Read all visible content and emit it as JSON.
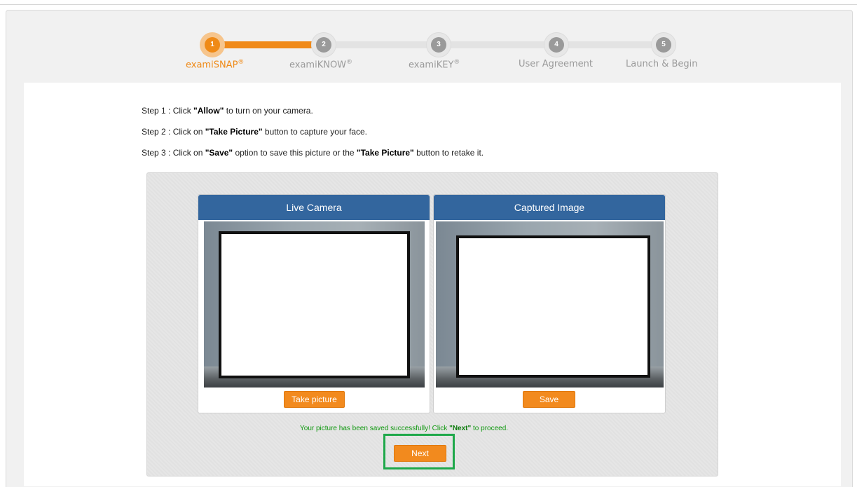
{
  "stepper": {
    "steps": [
      {
        "number": "1",
        "label": "examiSNAP",
        "mark": "®"
      },
      {
        "number": "2",
        "label": "examiKNOW",
        "mark": "®"
      },
      {
        "number": "3",
        "label": "examiKEY",
        "mark": "®"
      },
      {
        "number": "4",
        "label": "User Agreement",
        "mark": ""
      },
      {
        "number": "5",
        "label": "Launch & Begin",
        "mark": ""
      }
    ],
    "active_step": 1,
    "colors": {
      "active": "#ef8a17",
      "inactive": "#9a9a9a"
    }
  },
  "instructions": {
    "step1": {
      "prefix": "Step 1 : Click ",
      "bold": "\"Allow\"",
      "suffix": " to turn on your camera."
    },
    "step2": {
      "prefix": "Step 2 : Click on ",
      "bold": "\"Take Picture\"",
      "suffix": " button to capture your face."
    },
    "step3": {
      "prefix": "Step 3 : Click on ",
      "bold1": "\"Save\"",
      "middle": " option to save this picture or the ",
      "bold2": "\"Take Picture\"",
      "suffix": " button to retake it."
    }
  },
  "live_camera": {
    "title": "Live Camera",
    "button": "Take picture"
  },
  "captured_image": {
    "title": "Captured Image",
    "button": "Save"
  },
  "status": {
    "prefix": "Your picture has been saved successfully! Click ",
    "bold": "\"Next\"",
    "suffix": " to proceed."
  },
  "next_button": "Next",
  "colors": {
    "header_blue": "#33669e",
    "button_orange": "#f28a1e",
    "success_green": "#119911",
    "highlight_green": "#1ea84a"
  }
}
